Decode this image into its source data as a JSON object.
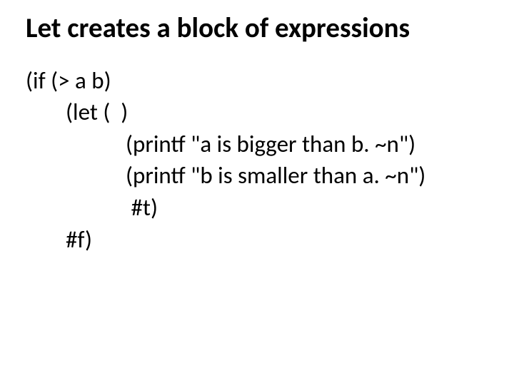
{
  "title": "Let creates a block of expressions",
  "code": {
    "l1": "(if (> a b)",
    "l2": "(let (  )",
    "l3": "(printf \"a is bigger than b. ~n\")",
    "l4": "(printf \"b is smaller than a. ~n\")",
    "l5": " #t)",
    "l6": "#f)"
  }
}
